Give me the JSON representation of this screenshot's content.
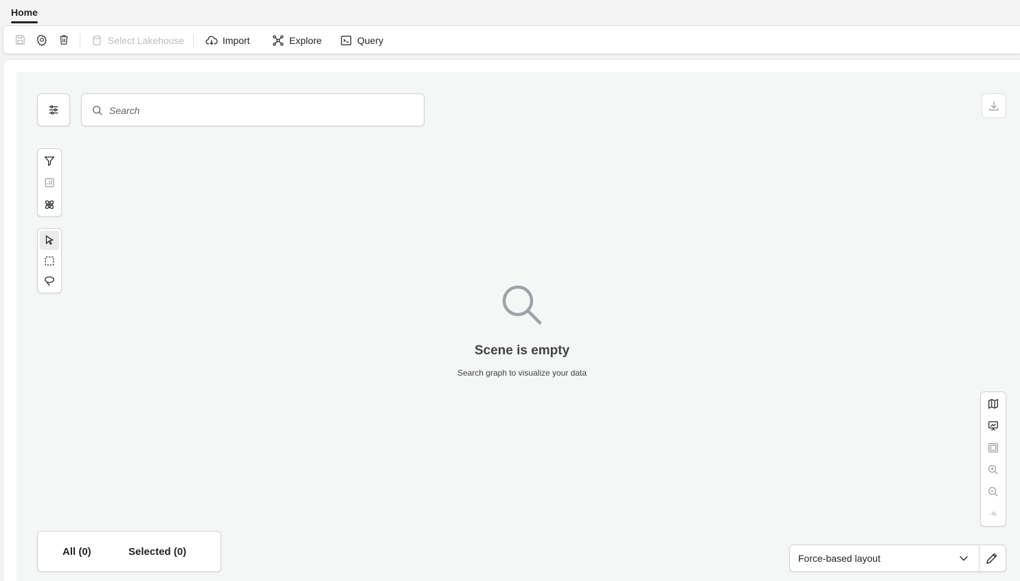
{
  "tabs": [
    {
      "label": "Home",
      "active": true
    }
  ],
  "toolbar": {
    "save_icon": "save-icon",
    "settings_icon": "gear-icon",
    "delete_icon": "trash-icon",
    "select_lakehouse_label": "Select Lakehouse",
    "import_label": "Import",
    "explore_label": "Explore",
    "query_label": "Query"
  },
  "search": {
    "placeholder": "Search",
    "value": ""
  },
  "empty_state": {
    "title": "Scene is empty",
    "subtitle": "Search graph to visualize your data"
  },
  "counts": {
    "all": "All (0)",
    "selected": "Selected (0)"
  },
  "layout": {
    "selected": "Force-based layout"
  },
  "zoom_percent_label": "-%",
  "colors": {
    "accent": "#242424",
    "canvas_bg": "#f5f6f6",
    "border": "#d1d1d1",
    "disabled": "#bdbdbd"
  }
}
